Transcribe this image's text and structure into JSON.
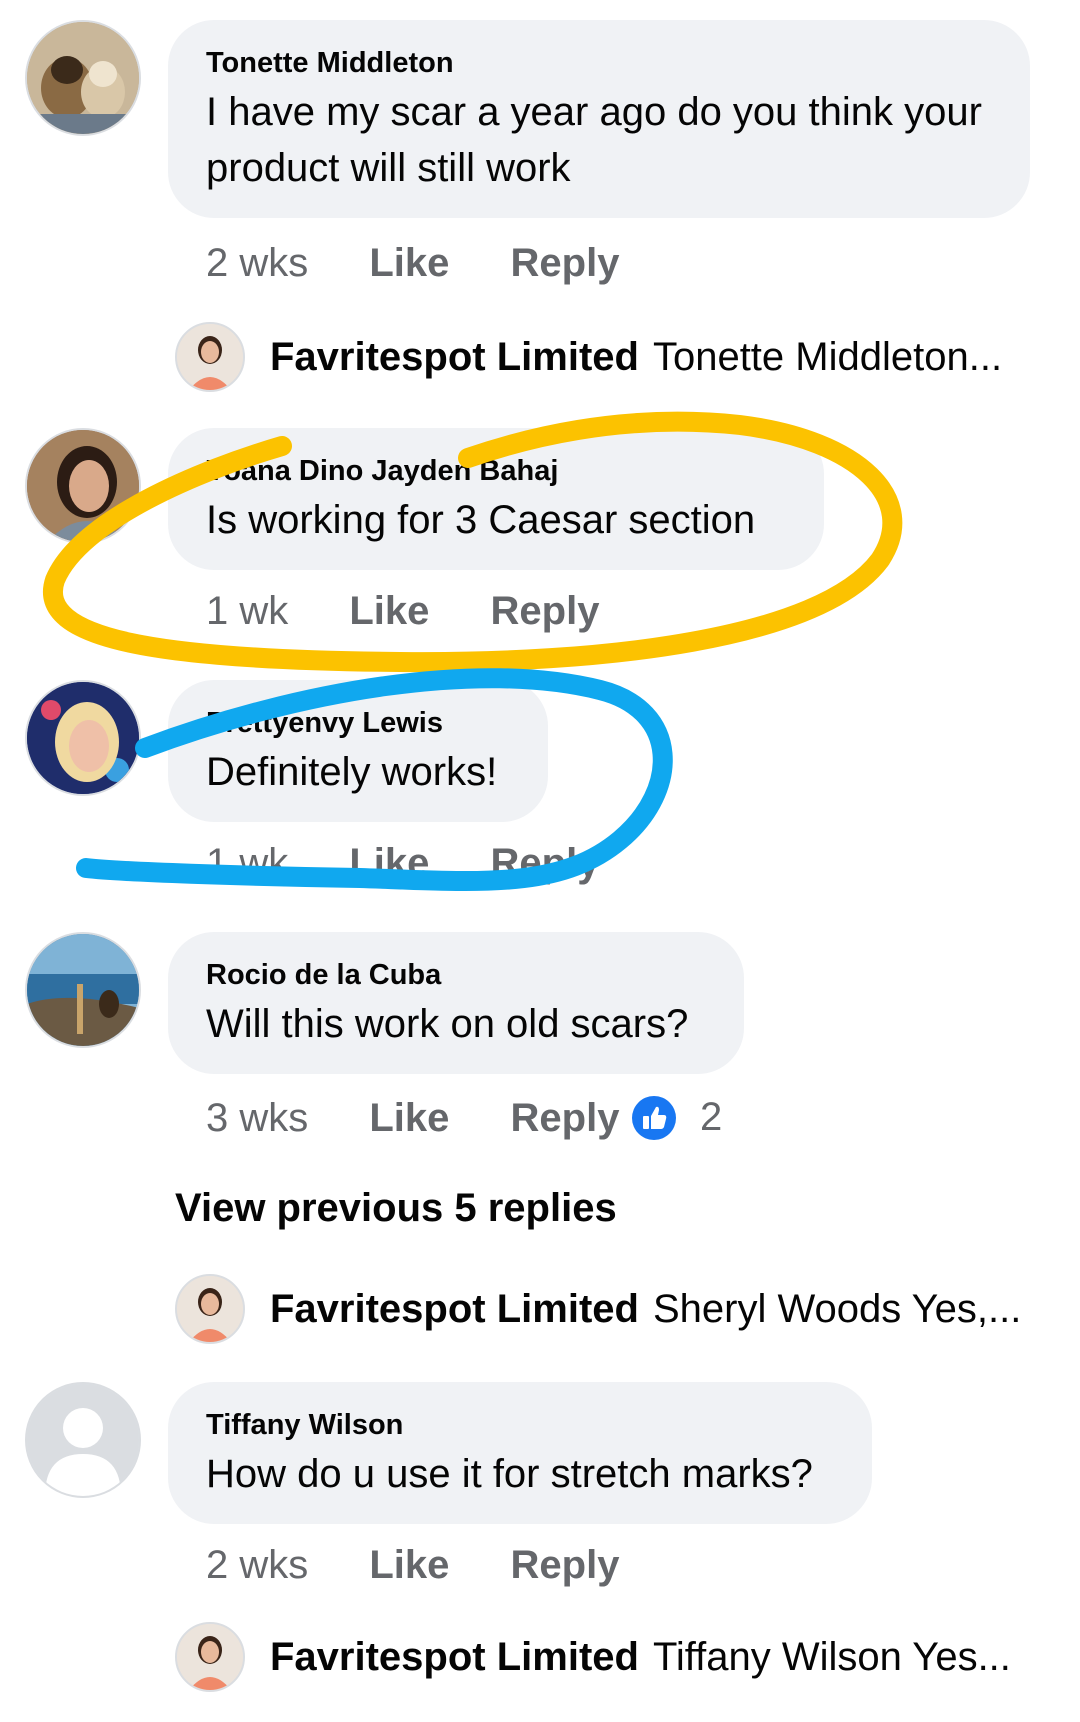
{
  "comments": [
    {
      "author": "Tonette Middleton",
      "text_line1": "I have my scar a year ago do you think your",
      "text_line2": "product will still work",
      "time": "2 wks",
      "like": "Like",
      "reply": "Reply"
    },
    {
      "author": "Yoana Dino Jayden Bahaj",
      "text": "Is working for 3 Caesar section",
      "time": "1 wk",
      "like": "Like",
      "reply": "Reply"
    },
    {
      "author": "Prettyenvy Lewis",
      "text": "Definitely works!",
      "time": "1 wk",
      "like": "Like",
      "reply": "Reply"
    },
    {
      "author": "Rocio de la Cuba",
      "text": "Will this work on old scars?",
      "time": "3 wks",
      "like": "Like",
      "reply": "Reply",
      "reaction_count": "2"
    },
    {
      "author": "Tiffany Wilson",
      "text": "How do u use it for stretch marks?",
      "time": "2 wks",
      "like": "Like",
      "reply": "Reply"
    }
  ],
  "replies": [
    {
      "author": "Favritespot Limited",
      "snippet": "Tonette Middleton..."
    },
    {
      "author": "Favritespot Limited",
      "snippet": "Sheryl Woods Yes,..."
    },
    {
      "author": "Favritespot Limited",
      "snippet": "Tiffany Wilson Yes..."
    }
  ],
  "view_previous": "View previous 5 replies",
  "colors": {
    "bubble": "#f0f2f5",
    "muted": "#65676b",
    "like_blue": "#1877f2",
    "yellow_mark": "#fcc200",
    "blue_mark": "#10a8ef"
  }
}
